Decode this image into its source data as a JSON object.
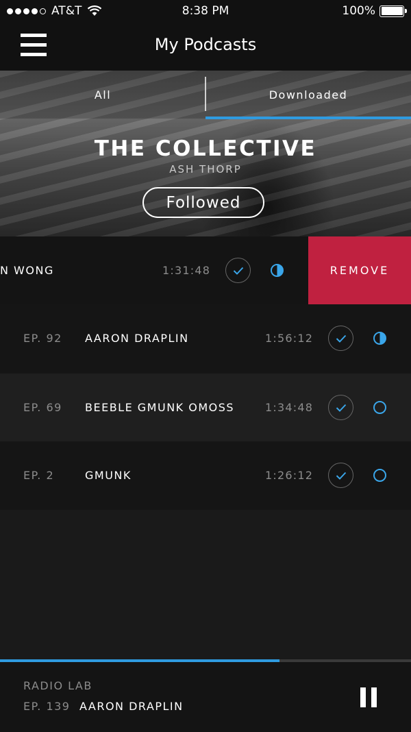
{
  "status_bar": {
    "carrier": "AT&T",
    "time": "8:38 PM",
    "battery": "100%"
  },
  "nav": {
    "title": "My Podcasts"
  },
  "tabs": [
    {
      "label": "All",
      "active": false
    },
    {
      "label": "Downloaded",
      "active": true
    }
  ],
  "show": {
    "title": "THE COLLECTIVE",
    "author": "ASH THORP",
    "follow_label": "Followed"
  },
  "swiped_episode": {
    "name": "N WONG",
    "duration": "1:31:48",
    "status": "half",
    "remove_label": "REMOVE"
  },
  "episodes": [
    {
      "number": "EP. 92",
      "name": "AARON DRAPLIN",
      "duration": "1:56:12",
      "status": "half"
    },
    {
      "number": "EP. 69",
      "name": "BEEBLE GMUNK OMOSS",
      "duration": "1:34:48",
      "status": "empty"
    },
    {
      "number": "EP. 2",
      "name": "GMUNK",
      "duration": "1:26:12",
      "status": "empty"
    }
  ],
  "now_playing": {
    "show": "RADIO LAB",
    "episode_number": "EP. 139",
    "episode_name": "AARON DRAPLIN",
    "progress": 0.68
  },
  "colors": {
    "accent": "#2f9be0",
    "remove": "#c02140"
  }
}
